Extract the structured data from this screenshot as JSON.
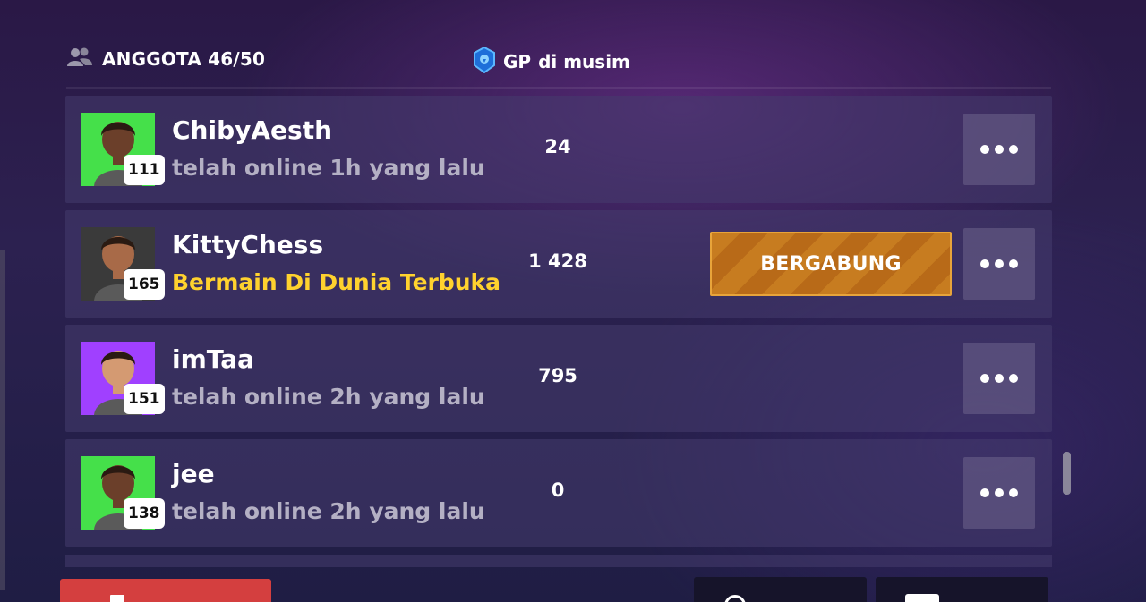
{
  "header": {
    "members_label": "ANGGOTA 46/50",
    "gp_label": "GP",
    "gp_suffix": "di musim"
  },
  "members": [
    {
      "name": "ChibyAesth",
      "level": "111",
      "status": "telah online 1h yang lalu",
      "status_active": false,
      "gp": "24",
      "avatar_bg": "#45e04a",
      "skin": "#6b3f2a",
      "has_join": false
    },
    {
      "name": "KittyChess",
      "level": "165",
      "status": "Bermain Di Dunia Terbuka",
      "status_active": true,
      "gp": "1 428",
      "avatar_bg": "#3a3a3a",
      "skin": "#a86a48",
      "has_join": true,
      "join_label": "BERGABUNG"
    },
    {
      "name": "imTaa",
      "level": "151",
      "status": "telah online 2h yang lalu",
      "status_active": false,
      "gp": "795",
      "avatar_bg": "#a040ff",
      "skin": "#d49a72",
      "has_join": false
    },
    {
      "name": "jee",
      "level": "138",
      "status": "telah online 2h yang lalu",
      "status_active": false,
      "gp": "0",
      "avatar_bg": "#45e04a",
      "skin": "#6b3f2a",
      "has_join": false
    }
  ],
  "icons": {
    "members": "people-icon",
    "gp": "gp-shield-icon",
    "menu": "more-dots-icon"
  },
  "colors": {
    "status_active": "#ffd22e",
    "join_button": "#c77c20",
    "leave_button": "#d43f3f"
  }
}
